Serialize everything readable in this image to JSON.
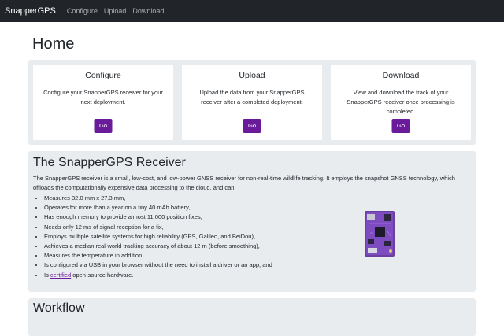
{
  "nav": {
    "brand": "SnapperGPS",
    "links": [
      "Configure",
      "Upload",
      "Download"
    ]
  },
  "page_title": "Home",
  "cards": [
    {
      "title": "Configure",
      "text": "Configure your SnapperGPS receiver for your next deployment.",
      "button": "Go"
    },
    {
      "title": "Upload",
      "text": "Upload the data from your SnapperGPS receiver after a completed deployment.",
      "button": "Go"
    },
    {
      "title": "Download",
      "text": "View and download the track of your SnapperGPS receiver once processing is completed.",
      "button": "Go"
    }
  ],
  "receiver": {
    "heading": "The SnapperGPS Receiver",
    "intro": "The SnapperGPS receiver is a small, low-cost, and low-power GNSS receiver for non-real-time wildlife tracking. It employs the snapshot GNSS technology, which offloads the computationally expensive data processing to the cloud, and can:",
    "features": [
      "Measures 32.0 mm x 27.3 mm,",
      "Operates for more than a year on a tiny 40 mAh battery,",
      "Has enough memory to provide almost 11,000 position fixes,",
      "Needs only 12 ms of signal reception for a fix,",
      "Employs multiple satellite systems for high reliability (GPS, Galileo, and BeiDou),",
      "Achieves a median real-world tracking accuracy of about 12 m (before smoothing),",
      "Measures the temperature in addition,",
      "Is configured via USB in your browser without the need to install a driver or an app, and"
    ],
    "last_feature_prefix": "Is ",
    "last_feature_link": "certified",
    "last_feature_suffix": " open-source hardware."
  },
  "workflow_heading": "Workflow",
  "colors": {
    "navbar": "#212529",
    "button": "#6a1b9a",
    "jumbotron": "#e9ecef",
    "board": "#6b3fa0"
  }
}
